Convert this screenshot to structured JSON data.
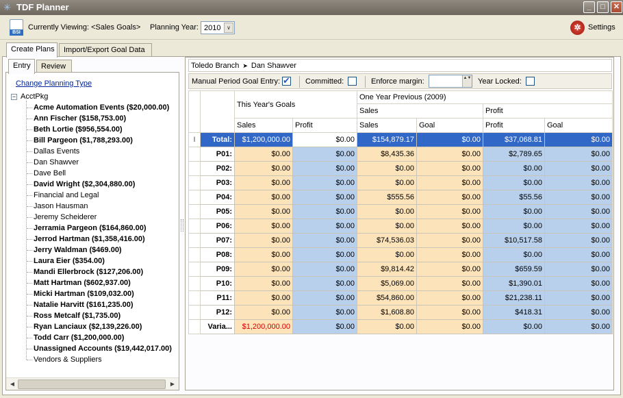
{
  "window": {
    "title": "TDF Planner",
    "min": "_",
    "max": "□",
    "close": "✕",
    "app_icon": "✳"
  },
  "toolbar": {
    "bsi_badge": "BSI",
    "currently_viewing": "Currently Viewing: <Sales Goals>",
    "planning_year_label": "Planning Year:",
    "planning_year": "2010",
    "dropdown_glyph": "∨",
    "settings_glyph": "✲",
    "settings": "Settings"
  },
  "tabs": {
    "create": "Create Plans",
    "import": "Import/Export Goal Data",
    "entry": "Entry",
    "review": "Review"
  },
  "sidebar": {
    "change_link": "Change Planning Type",
    "root_toggle": "−",
    "root": "AcctPkg",
    "items": [
      {
        "label": "Acme Automation Events ($20,000.00)",
        "bold": true
      },
      {
        "label": "Ann Fischer ($158,753.00)",
        "bold": true
      },
      {
        "label": "Beth Lortie ($956,554.00)",
        "bold": true
      },
      {
        "label": "Bill Pargeon ($1,788,293.00)",
        "bold": true
      },
      {
        "label": "Dallas Events",
        "bold": false
      },
      {
        "label": "Dan Shawver",
        "bold": false
      },
      {
        "label": "Dave Bell",
        "bold": false
      },
      {
        "label": "David Wright ($2,304,880.00)",
        "bold": true
      },
      {
        "label": "Financial and Legal",
        "bold": false
      },
      {
        "label": "Jason Hausman",
        "bold": false
      },
      {
        "label": "Jeremy Scheiderer",
        "bold": false
      },
      {
        "label": "Jerramia Pargeon ($164,860.00)",
        "bold": true
      },
      {
        "label": "Jerrod Hartman ($1,358,416.00)",
        "bold": true
      },
      {
        "label": "Jerry Waldman ($469.00)",
        "bold": true
      },
      {
        "label": "Laura Eier ($354.00)",
        "bold": true
      },
      {
        "label": "Mandi Ellerbrock ($127,206.00)",
        "bold": true
      },
      {
        "label": "Matt Hartman ($602,937.00)",
        "bold": true
      },
      {
        "label": "Micki Hartman ($109,032.00)",
        "bold": true
      },
      {
        "label": "Natalie Harvitt ($161,235.00)",
        "bold": true
      },
      {
        "label": "Ross Metcalf ($1,735.00)",
        "bold": true
      },
      {
        "label": "Ryan Lanciaux ($2,139,226.00)",
        "bold": true
      },
      {
        "label": "Todd Carr ($1,200,000.00)",
        "bold": true
      },
      {
        "label": "Unassigned Accounts ($19,442,017.00)",
        "bold": true
      },
      {
        "label": "Vendors & Suppliers",
        "bold": false
      }
    ],
    "scroll_left": "◀",
    "scroll_right": "▶"
  },
  "breadcrumb": {
    "branch": "Toledo Branch",
    "separator": "➤",
    "person": "Dan Shawver"
  },
  "options": {
    "manual_period": "Manual Period Goal Entry:",
    "manual_period_checked": true,
    "committed": "Committed:",
    "committed_checked": false,
    "enforce_margin": "Enforce margin:",
    "enforce_margin_value": "",
    "year_locked": "Year Locked:",
    "year_locked_checked": false,
    "spin_glyphs": "▲▼"
  },
  "grid": {
    "this_year_header": "This Year's Goals",
    "prev_year_header": "One Year Previous (2009)",
    "prev_sales_header": "Sales",
    "prev_profit_header": "Profit",
    "columns": [
      "Sales",
      "Profit",
      "Sales",
      "Goal",
      "Profit",
      "Goal"
    ],
    "row_selector_glyph": "I",
    "rows": [
      {
        "label": "Total:",
        "cells": [
          "$1,200,000.00",
          "$0.00",
          "$154,879.17",
          "$0.00",
          "$37,068.81",
          "$0.00"
        ]
      },
      {
        "label": "P01:",
        "cells": [
          "$0.00",
          "$0.00",
          "$8,435.36",
          "$0.00",
          "$2,789.65",
          "$0.00"
        ]
      },
      {
        "label": "P02:",
        "cells": [
          "$0.00",
          "$0.00",
          "$0.00",
          "$0.00",
          "$0.00",
          "$0.00"
        ]
      },
      {
        "label": "P03:",
        "cells": [
          "$0.00",
          "$0.00",
          "$0.00",
          "$0.00",
          "$0.00",
          "$0.00"
        ]
      },
      {
        "label": "P04:",
        "cells": [
          "$0.00",
          "$0.00",
          "$555.56",
          "$0.00",
          "$55.56",
          "$0.00"
        ]
      },
      {
        "label": "P05:",
        "cells": [
          "$0.00",
          "$0.00",
          "$0.00",
          "$0.00",
          "$0.00",
          "$0.00"
        ]
      },
      {
        "label": "P06:",
        "cells": [
          "$0.00",
          "$0.00",
          "$0.00",
          "$0.00",
          "$0.00",
          "$0.00"
        ]
      },
      {
        "label": "P07:",
        "cells": [
          "$0.00",
          "$0.00",
          "$74,536.03",
          "$0.00",
          "$10,517.58",
          "$0.00"
        ]
      },
      {
        "label": "P08:",
        "cells": [
          "$0.00",
          "$0.00",
          "$0.00",
          "$0.00",
          "$0.00",
          "$0.00"
        ]
      },
      {
        "label": "P09:",
        "cells": [
          "$0.00",
          "$0.00",
          "$9,814.42",
          "$0.00",
          "$659.59",
          "$0.00"
        ]
      },
      {
        "label": "P10:",
        "cells": [
          "$0.00",
          "$0.00",
          "$5,069.00",
          "$0.00",
          "$1,390.01",
          "$0.00"
        ]
      },
      {
        "label": "P11:",
        "cells": [
          "$0.00",
          "$0.00",
          "$54,860.00",
          "$0.00",
          "$21,238.11",
          "$0.00"
        ]
      },
      {
        "label": "P12:",
        "cells": [
          "$0.00",
          "$0.00",
          "$1,608.80",
          "$0.00",
          "$418.31",
          "$0.00"
        ]
      },
      {
        "label": "Varia...",
        "cells": [
          "$1,200,000.00",
          "$0.00",
          "$0.00",
          "$0.00",
          "$0.00",
          "$0.00"
        ]
      }
    ],
    "colors": {
      "goal_cell": "#fde3b9",
      "history_cell": "#b8d0ec",
      "selected_row": "#3167c7",
      "variance_text": "#d40000"
    }
  }
}
